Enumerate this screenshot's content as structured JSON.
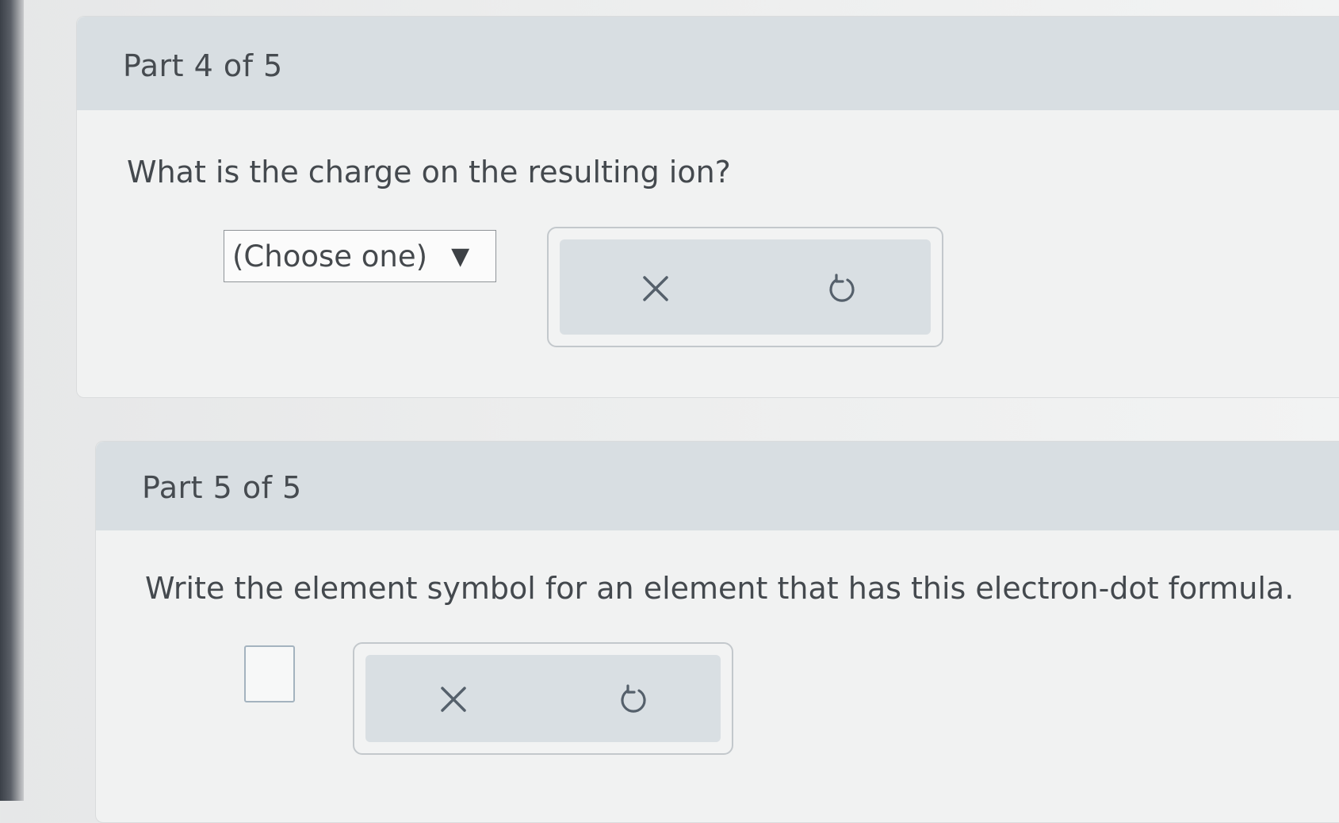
{
  "part4": {
    "title": "Part 4 of 5",
    "question": "What is the charge on the resulting ion?",
    "select": {
      "value": "(Choose one)",
      "arrow": "▼"
    },
    "tools": {
      "clear_icon": "close-icon",
      "undo_icon": "undo-icon"
    }
  },
  "part5": {
    "title": "Part 5 of 5",
    "question": "Write the element symbol for an element that has this electron-dot formula.",
    "answer_input": {
      "value": ""
    },
    "tools": {
      "clear_icon": "close-icon",
      "undo_icon": "undo-icon"
    }
  },
  "colors": {
    "header_bg": "#d8dee2",
    "panel_bg": "#f1f2f2",
    "icon_stroke": "#55606b",
    "input_border": "#a4b3bf"
  }
}
